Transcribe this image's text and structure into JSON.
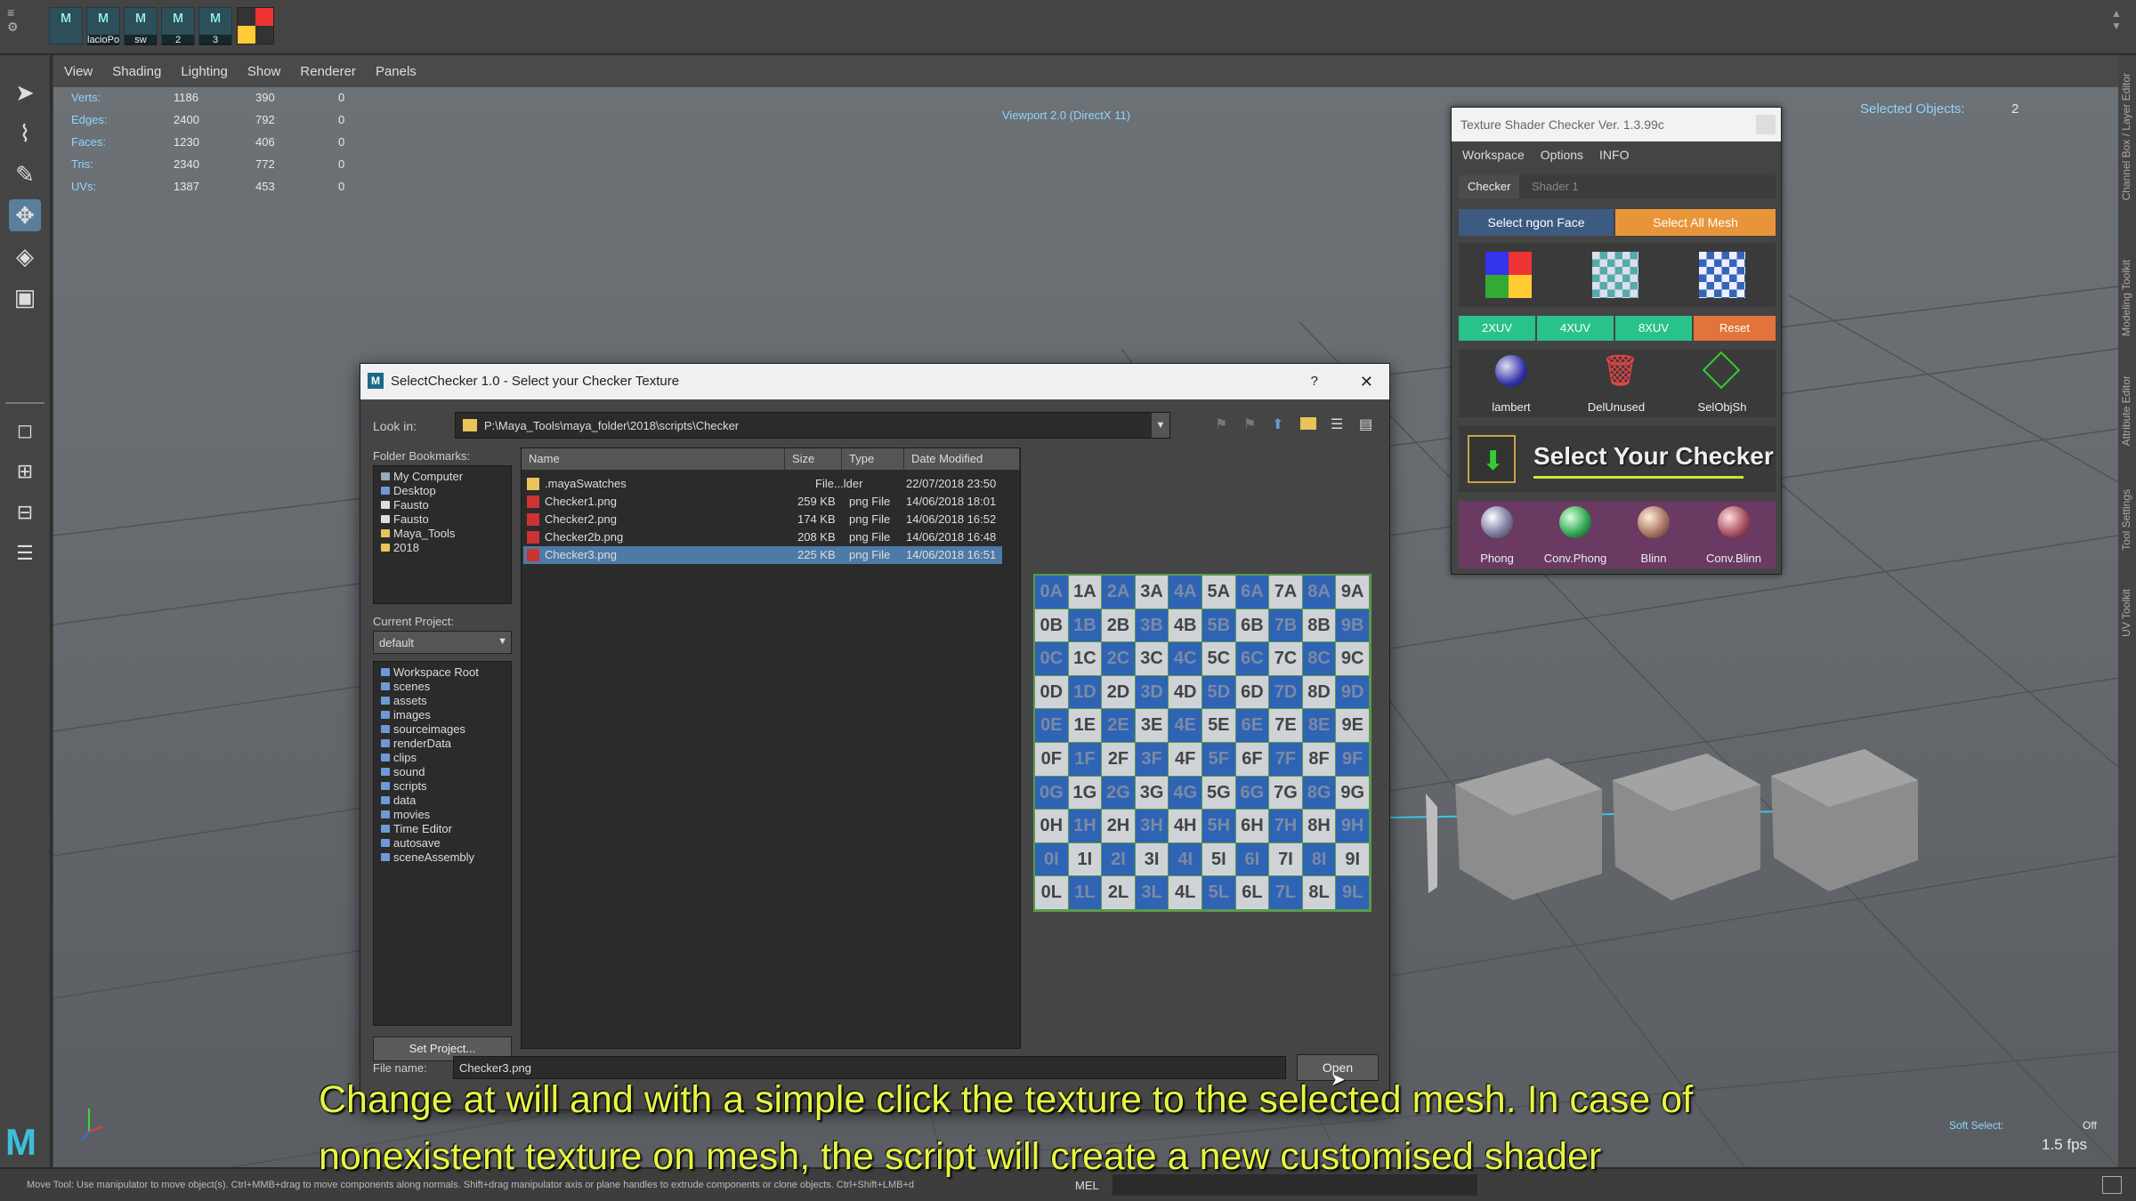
{
  "shelf": {
    "labels": [
      "",
      "lacioPo",
      "sw",
      "2",
      "3"
    ]
  },
  "viewport": {
    "menu": [
      "View",
      "Shading",
      "Lighting",
      "Show",
      "Renderer",
      "Panels"
    ],
    "renderer_label": "Viewport 2.0 (DirectX 11)",
    "selected_objects_label": "Selected Objects:",
    "selected_objects_value": "2",
    "soft_select_label": "Soft Select:",
    "soft_select_value": "Off",
    "fps": "1.5 fps",
    "hud_stats": [
      {
        "label": "Verts:",
        "a": "1186",
        "b": "390",
        "c": "0"
      },
      {
        "label": "Edges:",
        "a": "2400",
        "b": "792",
        "c": "0"
      },
      {
        "label": "Faces:",
        "a": "1230",
        "b": "406",
        "c": "0"
      },
      {
        "label": "Tris:",
        "a": "2340",
        "b": "772",
        "c": "0"
      },
      {
        "label": "UVs:",
        "a": "1387",
        "b": "453",
        "c": "0"
      }
    ]
  },
  "right_tabs": [
    "Channel Box / Layer Editor",
    "Modeling Toolkit",
    "Attribute Editor",
    "Tool Settings",
    "UV Toolkit"
  ],
  "status": {
    "help": "Move Tool: Use manipulator to move object(s). Ctrl+MMB+drag to move components along normals. Shift+drag manipulator axis or plane handles to extrude components or clone objects. Ctrl+Shift+LMB+d",
    "mel": "MEL"
  },
  "tsc": {
    "title": "Texture Shader Checker Ver. 1.3.99c",
    "menu": [
      "Workspace",
      "Options",
      "INFO"
    ],
    "tabs": [
      "Checker",
      "Shader 1"
    ],
    "select_ngon": "Select ngon Face",
    "select_all": "Select All Mesh",
    "uv_buttons": [
      "2XUV",
      "4XUV",
      "8XUV",
      "Reset"
    ],
    "tools": [
      "lambert",
      "DelUnused",
      "SelObjSh"
    ],
    "banner": "Select Your Checker",
    "shaders": [
      "Phong",
      "Conv.Phong",
      "Blinn",
      "Conv.Blinn"
    ],
    "colors": {
      "uv_green": "#29c28a",
      "reset_orange": "#e0743a",
      "select_all_orange": "#e8953a",
      "select_ngon_blue": "#3d5a80"
    }
  },
  "dialog": {
    "title": "SelectChecker 1.0 - Select your Checker Texture",
    "help_glyph": "?",
    "close_glyph": "✕",
    "look_in_label": "Look in:",
    "look_in_path": "P:\\Maya_Tools\\maya_folder\\2018\\scripts\\Checker",
    "bookmarks_label": "Folder Bookmarks:",
    "bookmarks": [
      "My Computer",
      "Desktop",
      "Fausto",
      "Fausto",
      "Maya_Tools",
      "2018"
    ],
    "current_project_label": "Current Project:",
    "current_project": "default",
    "project_dirs": [
      "Workspace Root",
      "scenes",
      "assets",
      "images",
      "sourceimages",
      "renderData",
      "clips",
      "sound",
      "scripts",
      "data",
      "movies",
      "Time Editor",
      "autosave",
      "sceneAssembly"
    ],
    "set_project": "Set Project...",
    "columns": [
      "Name",
      "Size",
      "Type",
      "Date Modified"
    ],
    "files": [
      {
        "name": ".mayaSwatches",
        "size": "",
        "type": "File...lder",
        "date": "22/07/2018 23:50",
        "selected": false
      },
      {
        "name": "Checker1.png",
        "size": "259 KB",
        "type": "png File",
        "date": "14/06/2018 18:01",
        "selected": false
      },
      {
        "name": "Checker2.png",
        "size": "174 KB",
        "type": "png File",
        "date": "14/06/2018 16:52",
        "selected": false
      },
      {
        "name": "Checker2b.png",
        "size": "208 KB",
        "type": "png File",
        "date": "14/06/2018 16:48",
        "selected": false
      },
      {
        "name": "Checker3.png",
        "size": "225 KB",
        "type": "png File",
        "date": "14/06/2018 16:51",
        "selected": true
      }
    ],
    "file_name_label": "File name:",
    "file_name": "Checker3.png",
    "open_button": "Open",
    "preview_columns": [
      "0",
      "1",
      "2",
      "3",
      "4",
      "5",
      "6",
      "7",
      "8",
      "9"
    ],
    "preview_rows": [
      "A",
      "B",
      "C",
      "D",
      "E",
      "F",
      "G",
      "H",
      "I",
      "L"
    ],
    "preview_colors": {
      "blue": "#2f63b4",
      "light": "#cfd2d6"
    }
  },
  "subtitles": [
    "Change at will and with a simple click the texture to the selected mesh. In case of",
    "nonexistent texture on mesh, the script will create a new customised shader"
  ]
}
